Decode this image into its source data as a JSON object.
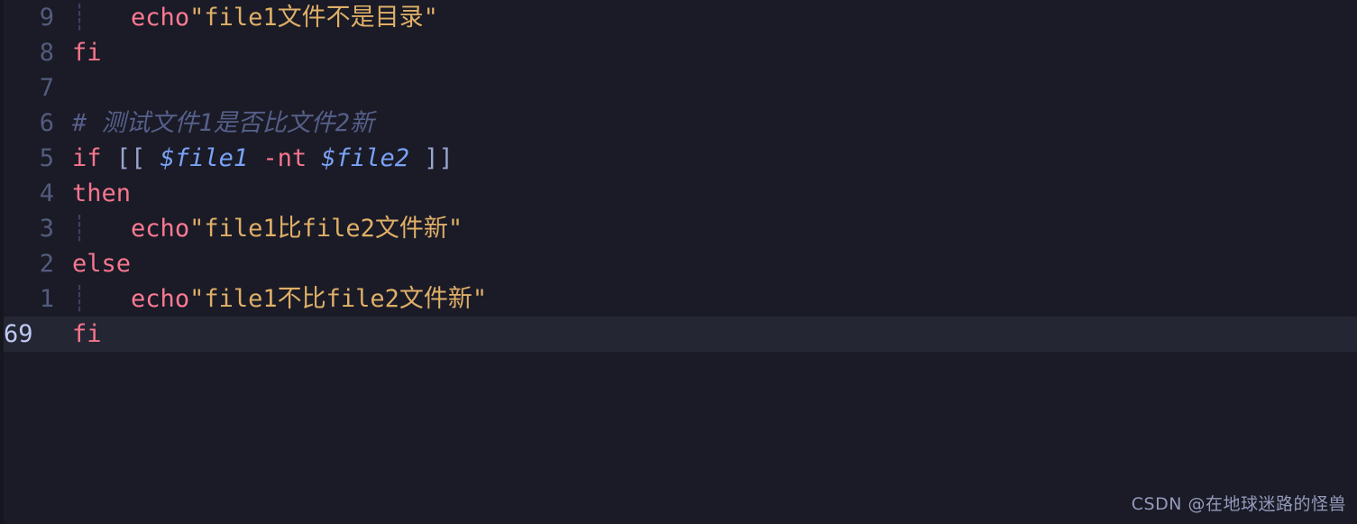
{
  "editor": {
    "app": "vim-terminal-editor",
    "language": "bash",
    "theme": "tokyo-night",
    "background_color": "#1a1b26",
    "current_line_background": "#242633",
    "gutter_color": "#545c7e",
    "current_line_number_color": "#c0caf5",
    "indent_guide_glyph": "┊",
    "indent_guide_color": "#3b4261",
    "colors": {
      "keyword": "#f7768e",
      "string": "#e0af68",
      "variable": "#7aa2f7",
      "punctuation": "#9aa5ce",
      "comment": "#565f89",
      "plain": "#c0caf5"
    },
    "absolute_line_number": "69",
    "lines": [
      {
        "number": "9",
        "indent_guide": true,
        "tokens": [
          {
            "text": "    ",
            "kind": "plain"
          },
          {
            "text": "echo",
            "kind": "builtin"
          },
          {
            "text": " ",
            "kind": "plain"
          },
          {
            "text": "\"file1文件不是目录\"",
            "kind": "string"
          }
        ],
        "plain_text": "    echo \"file1文件不是目录\""
      },
      {
        "number": "8",
        "indent_guide": false,
        "tokens": [
          {
            "text": "fi",
            "kind": "keyword"
          }
        ],
        "plain_text": "fi"
      },
      {
        "number": "7",
        "indent_guide": false,
        "tokens": [],
        "plain_text": ""
      },
      {
        "number": "6",
        "indent_guide": false,
        "tokens": [
          {
            "text": "# 测试文件1是否比文件2新",
            "kind": "comment"
          }
        ],
        "plain_text": "# 测试文件1是否比文件2新"
      },
      {
        "number": "5",
        "indent_guide": false,
        "tokens": [
          {
            "text": "if",
            "kind": "keyword"
          },
          {
            "text": " ",
            "kind": "plain"
          },
          {
            "text": "[[",
            "kind": "punct"
          },
          {
            "text": " ",
            "kind": "plain"
          },
          {
            "text": "$file1",
            "kind": "variable"
          },
          {
            "text": " ",
            "kind": "plain"
          },
          {
            "text": "-nt",
            "kind": "keyword"
          },
          {
            "text": " ",
            "kind": "plain"
          },
          {
            "text": "$file2",
            "kind": "variable"
          },
          {
            "text": " ",
            "kind": "plain"
          },
          {
            "text": "]]",
            "kind": "punct"
          }
        ],
        "plain_text": "if [[ $file1 -nt $file2 ]]"
      },
      {
        "number": "4",
        "indent_guide": false,
        "tokens": [
          {
            "text": "then",
            "kind": "keyword"
          }
        ],
        "plain_text": "then"
      },
      {
        "number": "3",
        "indent_guide": true,
        "tokens": [
          {
            "text": "    ",
            "kind": "plain"
          },
          {
            "text": "echo",
            "kind": "builtin"
          },
          {
            "text": " ",
            "kind": "plain"
          },
          {
            "text": "\"file1比file2文件新\"",
            "kind": "string"
          }
        ],
        "plain_text": "    echo \"file1比file2文件新\""
      },
      {
        "number": "2",
        "indent_guide": false,
        "tokens": [
          {
            "text": "else",
            "kind": "keyword"
          }
        ],
        "plain_text": "else"
      },
      {
        "number": "1",
        "indent_guide": true,
        "tokens": [
          {
            "text": "    ",
            "kind": "plain"
          },
          {
            "text": "echo",
            "kind": "builtin"
          },
          {
            "text": " ",
            "kind": "plain"
          },
          {
            "text": "\"file1不比file2文件新\"",
            "kind": "string"
          }
        ],
        "plain_text": "    echo \"file1不比file2文件新\""
      },
      {
        "number": "69",
        "current": true,
        "indent_guide": false,
        "tokens": [
          {
            "text": "fi",
            "kind": "keyword"
          }
        ],
        "plain_text": "fi"
      }
    ]
  },
  "watermark": {
    "text": "CSDN @在地球迷路的怪兽"
  }
}
